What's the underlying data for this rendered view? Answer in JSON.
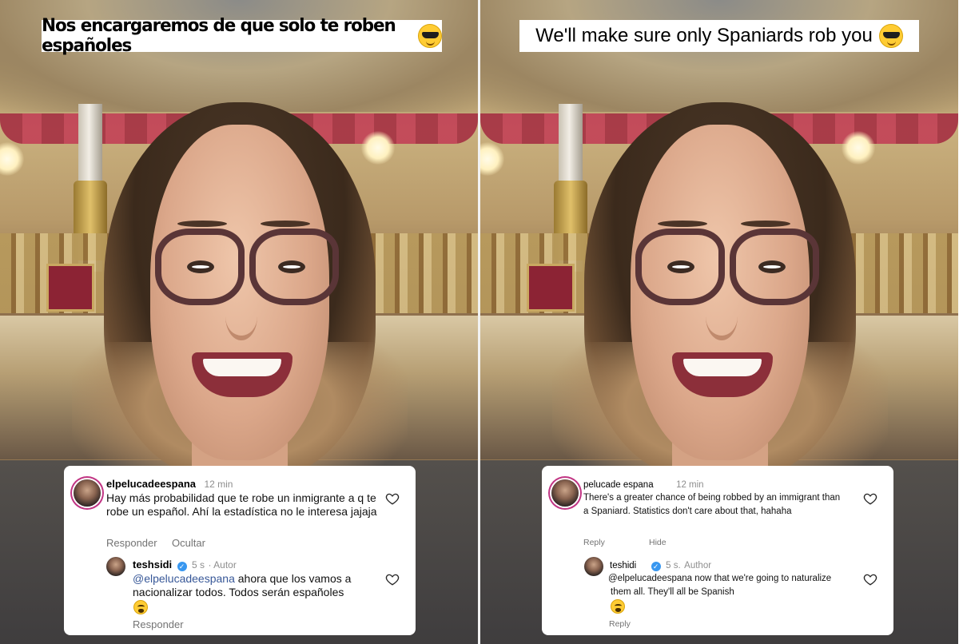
{
  "left": {
    "caption": "Nos encargaremos de que solo te roben españoles",
    "caption_emoji": "smiling-face-with-sunglasses",
    "comment": {
      "username": "elpelucadeespana",
      "time": "12 min",
      "text": "Hay más probabilidad que te robe un inmigrante a q te robe un español. Ahí la estadística no le interesa jajaja",
      "reply_label": "Responder",
      "hide_label": "Ocultar"
    },
    "reply": {
      "username": "teshsidi",
      "time": "5 s",
      "author_label": "Autor",
      "mention": "@elpelucadeespana",
      "text": "ahora que los vamos a nacionalizar todos. Todos serán españoles",
      "emoji": "shushing-face",
      "reply_label": "Responder"
    }
  },
  "right": {
    "caption": "We'll make sure only Spaniards rob you",
    "caption_emoji": "smiling-face-with-sunglasses",
    "comment": {
      "username": "pelucade espana",
      "time": "12 min",
      "text_line1": "There's a greater chance of being robbed by an immigrant than",
      "text_line2": "a Spaniard. Statistics don't care about that, hahaha",
      "reply_label": "Reply",
      "hide_label": "Hide"
    },
    "reply": {
      "username": "teshidi",
      "time": "5 s.",
      "author_label": "Author",
      "text_line1": "@elpelucadeespana now that we're going to naturalize",
      "text_line2": "them all. They'll all be Spanish",
      "emoji": "shushing-face",
      "reply_label": "Reply"
    }
  },
  "colors": {
    "mention": "#385898",
    "verified": "#3897f0",
    "story_ring": "#c13584"
  }
}
